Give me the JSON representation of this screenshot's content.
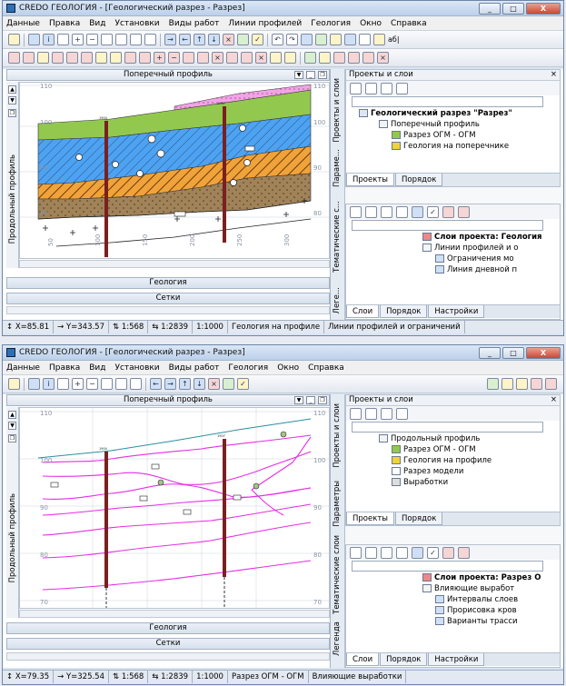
{
  "colors": {
    "accent": "#2e6fb8",
    "link": "#3d4f8e",
    "pink": "#f2a3e6",
    "lime": "#93c84f",
    "blue": "#4da3f2",
    "orange": "#f0a33a",
    "brown": "#a1835a",
    "magenta": "#e62ee6",
    "teal": "#2a8fa0",
    "ruler": "#5e6c80"
  },
  "w1": {
    "title": "CREDO ГЕОЛОГИЯ - [Геологический разрез - Разрез]",
    "menu": [
      "Данные",
      "Правка",
      "Вид",
      "Установки",
      "Виды работ",
      "Линии профилей",
      "Геология",
      "Окно",
      "Справка"
    ],
    "toolbar_text": "аб|",
    "panel_title": "Поперечный профиль",
    "left_vtab": "Продольный профиль",
    "bottom_bar1": "Геология",
    "bottom_bar2": "Сетки",
    "right_vtabs": [
      "Проекты и слои",
      "Парамe...",
      "Тематические с...",
      "Леге..."
    ],
    "projects_header": "Проекты и слои",
    "tree": [
      "Геологический разрез \"Разрез\"",
      "Поперечный профиль",
      "Разрез ОГМ - ОГМ",
      "Геология на поперечнике"
    ],
    "tabs1": [
      "Проекты",
      "Порядок"
    ],
    "layers_header": "Слои проекта: Геология",
    "layers": [
      "Линии профилей и о",
      "Ограничения мо",
      "Линия дневной п"
    ],
    "tabs2": [
      "Слои",
      "Порядок",
      "Настройки"
    ],
    "status": [
      "X=85.81",
      "Y=343.57",
      "1:568",
      "1:2839",
      "1:1000",
      "Геология на профиле",
      "Линии профилей и ограничений"
    ],
    "elev": [
      "110",
      "100",
      "90",
      "80"
    ],
    "dist": [
      "50",
      "100",
      "150",
      "200",
      "250",
      "300"
    ],
    "wells": [
      "1904",
      "1907"
    ]
  },
  "w2": {
    "title": "CREDO ГЕОЛОГИЯ - [Геологический разрез - Разрез]",
    "menu": [
      "Данные",
      "Правка",
      "Вид",
      "Установки",
      "Виды работ",
      "Геология",
      "Окно",
      "Справка"
    ],
    "panel_title": "Поперечный профиль",
    "left_vtab": "Продольный профиль",
    "bottom_bar1": "Геология",
    "bottom_bar2": "Сетки",
    "right_vtabs": [
      "Проекты и слои",
      "Параметры",
      "Тематические слои",
      "Легенда"
    ],
    "projects_header": "Проекты и слои",
    "tree": [
      "Продольный профиль",
      "Разрез ОГМ - ОГМ",
      "Геология на профиле",
      "Разрез модели",
      "Выработки"
    ],
    "tabs1": [
      "Проекты",
      "Порядок"
    ],
    "layers_header": "Слои проекта: Разрез О",
    "layers": [
      "Влияющие выработ",
      "Интервалы слоев",
      "Прорисовка кров",
      "Варианты трасси"
    ],
    "tabs2": [
      "Слои",
      "Порядок",
      "Настройки"
    ],
    "status": [
      "X=79.35",
      "Y=325.54",
      "1:568",
      "1:2839",
      "1:1000",
      "Разрез ОГМ - ОГМ",
      "Влияющие выработки"
    ],
    "elev": [
      "110",
      "100",
      "90",
      "80",
      "70"
    ],
    "wells": [
      "1904",
      "1907"
    ]
  }
}
